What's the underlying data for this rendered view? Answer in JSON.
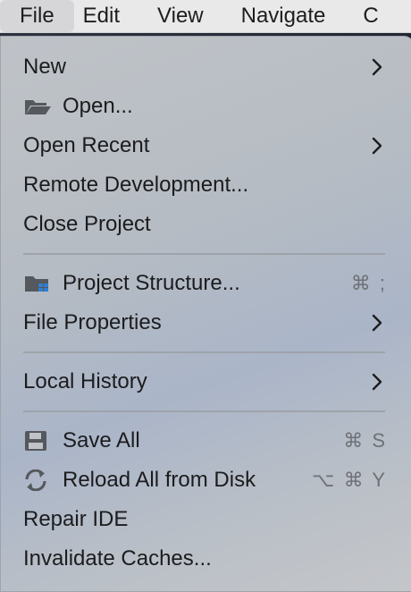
{
  "menubar": {
    "items": [
      "File",
      "Edit",
      "View",
      "Navigate",
      "C"
    ]
  },
  "menu": {
    "items": [
      {
        "label": "New",
        "submenu": true
      },
      {
        "label": "Open...",
        "icon": "folder-open-icon"
      },
      {
        "label": "Open Recent",
        "submenu": true
      },
      {
        "label": "Remote Development..."
      },
      {
        "label": "Close Project"
      },
      {
        "label": "Project Structure...",
        "icon": "project-structure-icon",
        "shortcut": "⌘ ;"
      },
      {
        "label": "File Properties",
        "submenu": true
      },
      {
        "label": "Local History",
        "submenu": true
      },
      {
        "label": "Save All",
        "icon": "save-icon",
        "shortcut": "⌘ S"
      },
      {
        "label": "Reload All from Disk",
        "icon": "reload-icon",
        "shortcut": "⌥ ⌘ Y"
      },
      {
        "label": "Repair IDE"
      },
      {
        "label": "Invalidate Caches..."
      }
    ]
  },
  "colors": {
    "menubar_bg": "#e9e9ea",
    "menu_bg": "#bfc3c8",
    "text": "#1c1c1e",
    "shortcut": "#6e7176"
  }
}
